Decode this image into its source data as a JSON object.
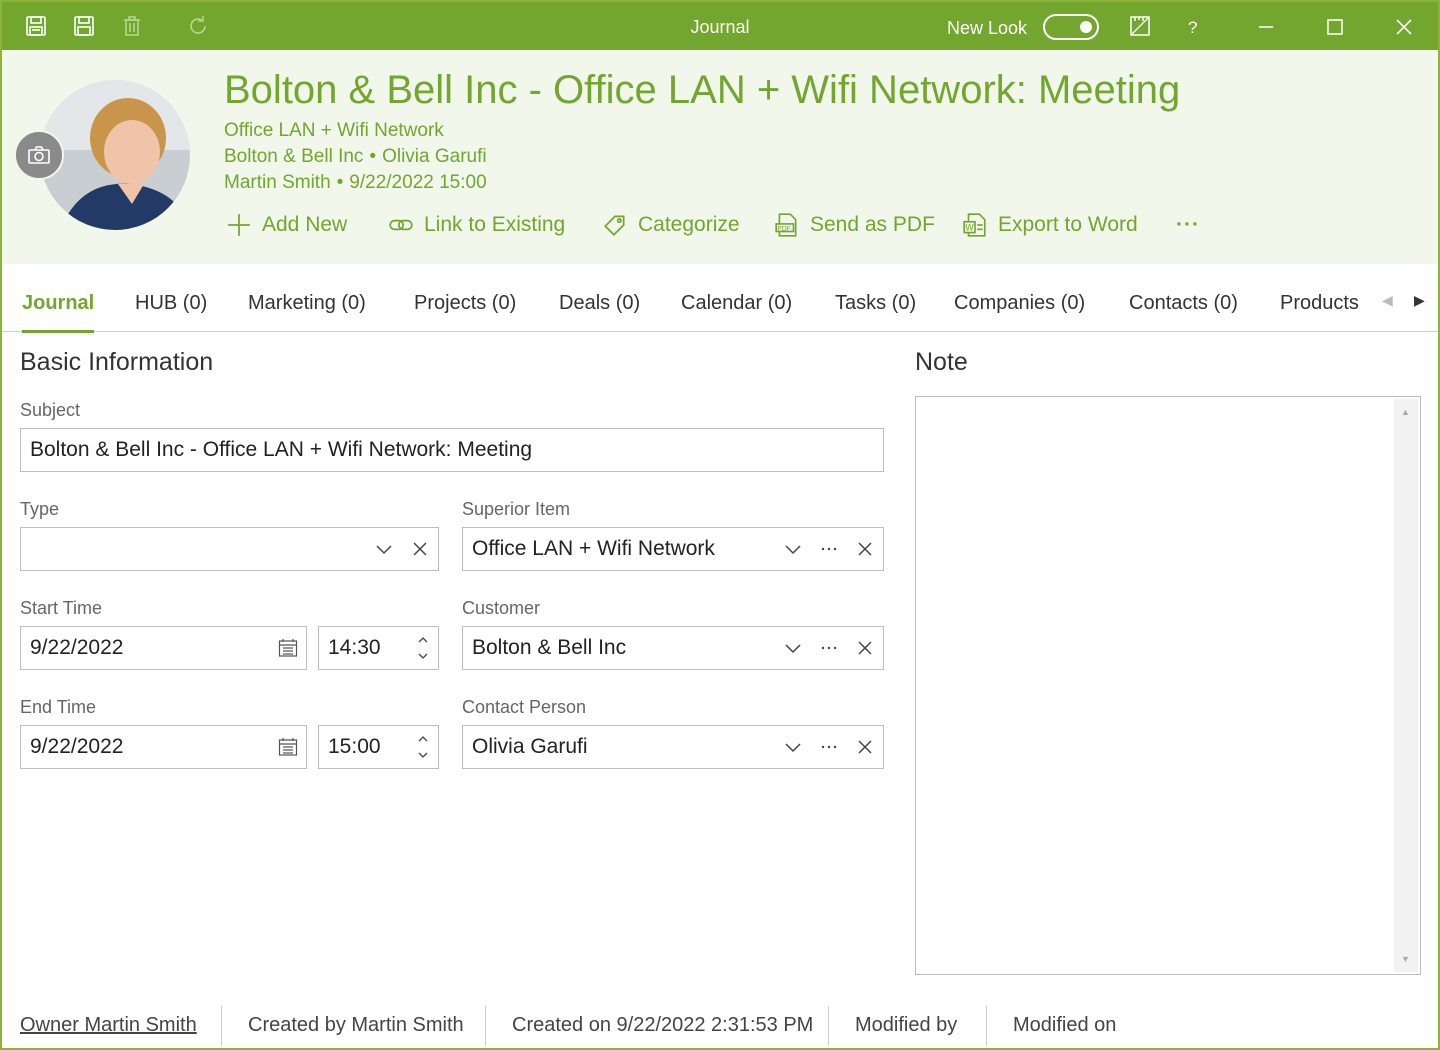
{
  "window": {
    "title": "Journal",
    "new_look_label": "New Look",
    "new_look_on": true,
    "help_label": "?"
  },
  "colors": {
    "accent": "#72a62e",
    "header_bg": "#f1f7ea"
  },
  "header": {
    "title": "Bolton & Bell Inc - Office LAN + Wifi Network: Meeting",
    "superior": "Office LAN + Wifi Network",
    "company": "Bolton & Bell Inc",
    "contact": "Olivia Garufi",
    "owner": "Martin Smith",
    "datetime": "9/22/2022 15:00",
    "separator": "•"
  },
  "actions": {
    "add_new": "Add New",
    "link_existing": "Link to Existing",
    "categorize": "Categorize",
    "send_pdf": "Send as PDF",
    "export_word": "Export to Word",
    "more": "···"
  },
  "tabs": [
    {
      "label": "Journal"
    },
    {
      "label": "HUB (0)"
    },
    {
      "label": "Marketing (0)"
    },
    {
      "label": "Projects (0)"
    },
    {
      "label": "Deals (0)"
    },
    {
      "label": "Calendar (0)"
    },
    {
      "label": "Tasks (0)"
    },
    {
      "label": "Companies (0)"
    },
    {
      "label": "Contacts (0)"
    },
    {
      "label": "Products"
    }
  ],
  "basic": {
    "title": "Basic Information",
    "subject_label": "Subject",
    "subject": "Bolton & Bell Inc - Office LAN + Wifi Network: Meeting",
    "type_label": "Type",
    "type": "",
    "superior_label": "Superior Item",
    "superior": "Office LAN + Wifi Network",
    "start_label": "Start Time",
    "start_date": "9/22/2022",
    "start_time": "14:30",
    "customer_label": "Customer",
    "customer": "Bolton & Bell Inc",
    "end_label": "End Time",
    "end_date": "9/22/2022",
    "end_time": "15:00",
    "contact_label": "Contact Person",
    "contact": "Olivia Garufi"
  },
  "note": {
    "title": "Note",
    "text": ""
  },
  "footer": {
    "owner": "Owner Martin Smith",
    "created_by": "Created by Martin Smith",
    "created_on": "Created on 9/22/2022 2:31:53 PM",
    "modified_by": "Modified by",
    "modified_on": "Modified on"
  }
}
